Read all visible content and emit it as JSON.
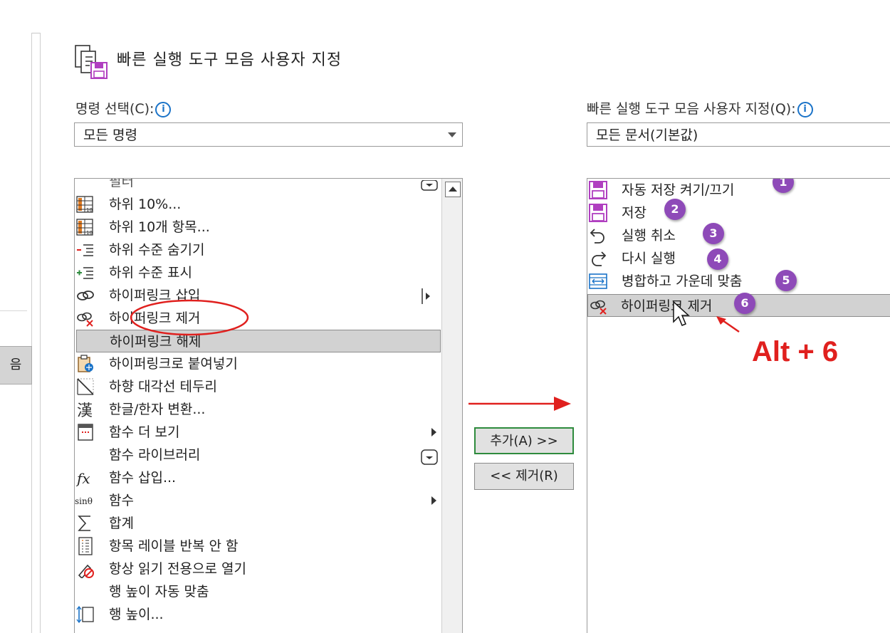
{
  "dialog": {
    "title": "빠른 실행 도구 모음 사용자 지정",
    "left_nav_tab": "음"
  },
  "left": {
    "label": "명령 선택(C):",
    "combo_value": "모든 명령",
    "items": [
      {
        "label": "필터",
        "icon": "filter-partial-icon",
        "submenu": false
      },
      {
        "label": "하위 10%...",
        "icon": "bottom-10-icon",
        "submenu": false
      },
      {
        "label": "하위 10개 항목...",
        "icon": "bottom-10-items-icon",
        "submenu": false
      },
      {
        "label": "하위 수준 숨기기",
        "icon": "hide-detail-icon",
        "submenu": false
      },
      {
        "label": "하위 수준 표시",
        "icon": "show-detail-icon",
        "submenu": false
      },
      {
        "label": "하이퍼링크 삽입",
        "icon": "link-icon",
        "submenu": true
      },
      {
        "label": "하이퍼링크 제거",
        "icon": "remove-link-icon",
        "submenu": false
      },
      {
        "label": "하이퍼링크 해제",
        "icon": "none",
        "submenu": false,
        "selected": true
      },
      {
        "label": "하이퍼링크로 붙여넣기",
        "icon": "paste-link-icon",
        "submenu": false
      },
      {
        "label": "하향 대각선 테두리",
        "icon": "diagonal-border-icon",
        "submenu": false
      },
      {
        "label": "한글/한자 변환...",
        "icon": "hanja-icon",
        "submenu": false
      },
      {
        "label": "함수 더 보기",
        "icon": "more-functions-icon",
        "submenu": true
      },
      {
        "label": "함수 라이브러리",
        "icon": "none",
        "submenu": false
      },
      {
        "label": "함수 삽입...",
        "icon": "fx-icon",
        "submenu": false
      },
      {
        "label": "함수",
        "icon": "sin-icon",
        "submenu": true
      },
      {
        "label": "합계",
        "icon": "sigma-icon",
        "submenu": false
      },
      {
        "label": "항목 레이블 반복 안 함",
        "icon": "label-repeat-icon",
        "submenu": false
      },
      {
        "label": "항상 읽기 전용으로 열기",
        "icon": "read-only-icon",
        "submenu": false
      },
      {
        "label": "행 높이 자동 맞춤",
        "icon": "none",
        "submenu": false
      },
      {
        "label": "행 높이...",
        "icon": "row-height-icon",
        "submenu": false
      }
    ]
  },
  "right": {
    "label": "빠른 실행 도구 모음 사용자 지정(Q):",
    "combo_value": "모든 문서(기본값)",
    "items": [
      {
        "label": "자동 저장 켜기/끄기",
        "icon": "autosave-icon",
        "badge": "1"
      },
      {
        "label": "저장",
        "icon": "save-icon",
        "badge": "2"
      },
      {
        "label": "실행 취소",
        "icon": "undo-icon",
        "badge": "3"
      },
      {
        "label": "다시 실행",
        "icon": "redo-icon",
        "badge": "4"
      },
      {
        "label": "병합하고 가운데 맞춤",
        "icon": "merge-center-icon",
        "badge": "5"
      },
      {
        "label": "하이퍼링크 제거",
        "icon": "remove-link-icon",
        "badge": "6",
        "selected": true
      }
    ]
  },
  "buttons": {
    "add": "추가(A) >>",
    "remove": "<< 제거(R)"
  },
  "annotation": {
    "shortcut": "Alt + 6",
    "color": "#e0201e"
  },
  "colors": {
    "badge": "#8e4ab8",
    "save_icon": "#b03fc0",
    "info": "#1a73c8"
  }
}
